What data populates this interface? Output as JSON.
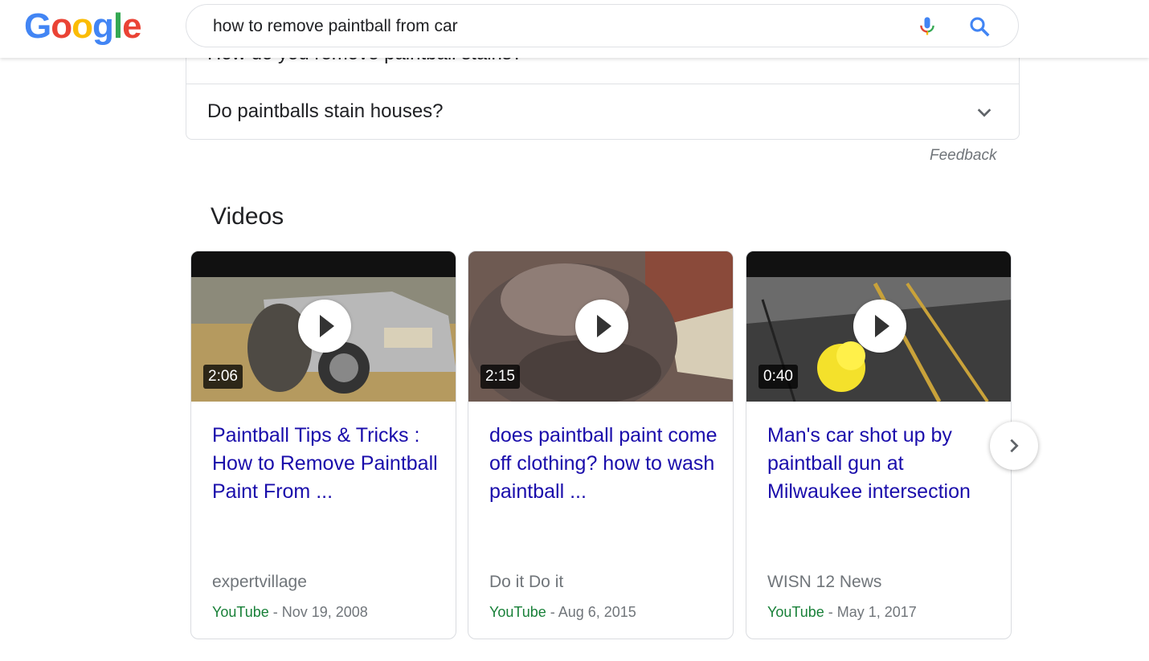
{
  "logo": {
    "text": "Google",
    "letters": [
      "G",
      "o",
      "o",
      "g",
      "l",
      "e"
    ]
  },
  "search": {
    "value": "how to remove paintball from car"
  },
  "paa": {
    "items": [
      {
        "question": "How do you remove paintball stains?"
      },
      {
        "question": "Do paintballs stain houses?"
      }
    ]
  },
  "feedback_label": "Feedback",
  "videos": {
    "title": "Videos",
    "cards": [
      {
        "duration": "2:06",
        "title": "Paintball Tips & Tricks : How to Remove Paintball Paint From ...",
        "channel": "expertvillage",
        "source": "YouTube",
        "date": " - Nov 19, 2008"
      },
      {
        "duration": "2:15",
        "title": "does paintball paint come off clothing? how to wash paintball ...",
        "channel": "Do it Do it",
        "source": "YouTube",
        "date": " - Aug 6, 2015"
      },
      {
        "duration": "0:40",
        "title": "Man's car shot up by paintball gun at Milwaukee intersection",
        "channel": "WISN 12 News",
        "source": "YouTube",
        "date": " - May 1, 2017"
      }
    ]
  },
  "colors": {
    "link": "#1a0dab",
    "source_green": "#188038",
    "muted": "#70757a"
  },
  "icons": {
    "mic": "mic-icon",
    "search": "search-icon",
    "chevron": "chevron-down-icon",
    "next": "chevron-right-icon",
    "play": "play-icon"
  }
}
